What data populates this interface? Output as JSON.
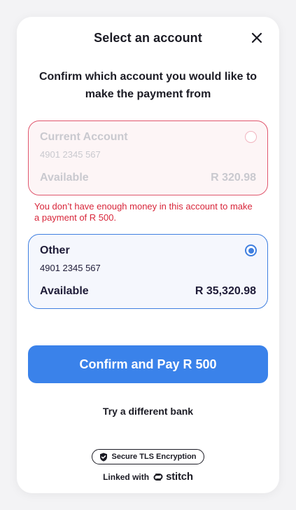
{
  "header": {
    "title": "Select an account"
  },
  "subtitle": "Confirm which account you would like to make the payment from",
  "accounts": [
    {
      "name": "Current Account",
      "number": "4901 2345 567",
      "available_label": "Available",
      "available_value": "R 320.98",
      "state": "disabled"
    },
    {
      "name": "Other",
      "number": "4901 2345 567",
      "available_label": "Available",
      "available_value": "R 35,320.98",
      "state": "selected"
    }
  ],
  "error_message": "You don’t have enough money in this account to make a payment of R 500.",
  "confirm_button": "Confirm and Pay R 500",
  "alt_link": "Try a different bank",
  "security_badge": "Secure TLS Encryption",
  "footer": {
    "linked_with": "Linked with",
    "brand": "stitch"
  },
  "icons": {
    "close": "close-icon",
    "shield": "shield-check-icon",
    "brand_logo": "stitch-logo-icon"
  },
  "colors": {
    "primary": "#3a82ea",
    "error": "#d8263a",
    "disabled_border": "#e0576e",
    "selected_border": "#3f7fe0"
  }
}
